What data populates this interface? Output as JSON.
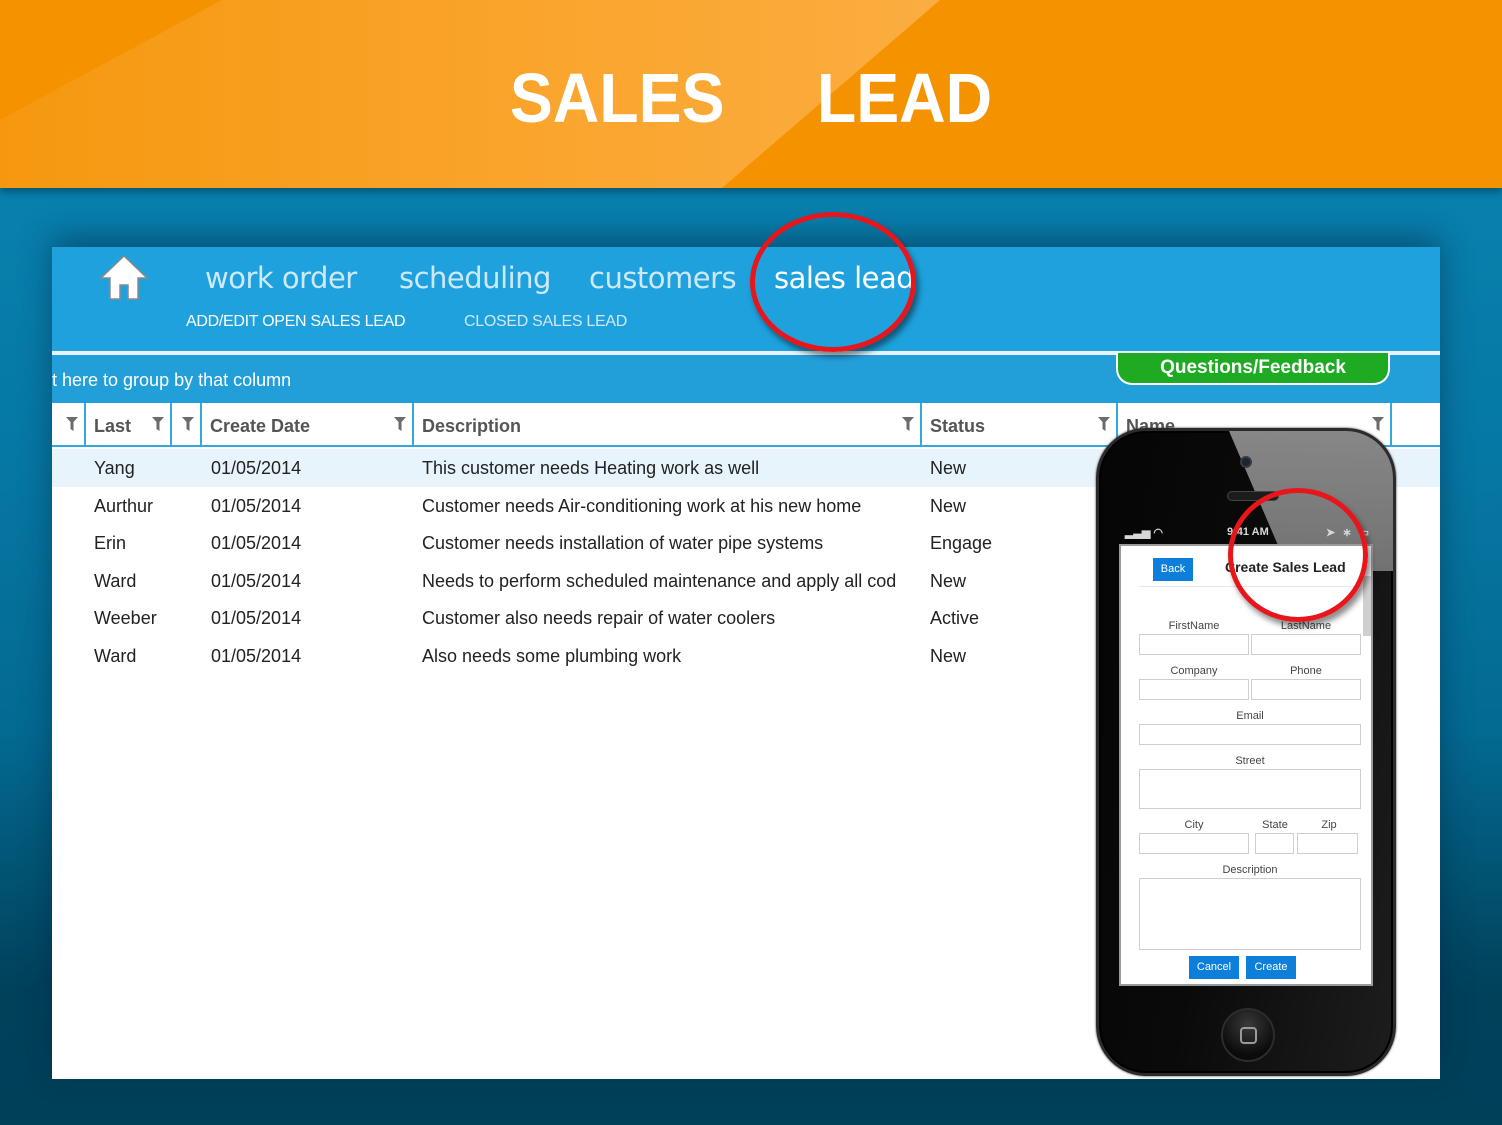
{
  "banner": {
    "title": "SALES   LEAD"
  },
  "nav": {
    "home_icon": "home-icon",
    "items": [
      {
        "label": "work order",
        "active": false
      },
      {
        "label": "scheduling",
        "active": false
      },
      {
        "label": "customers",
        "active": false
      },
      {
        "label": "sales lead",
        "active": true
      }
    ],
    "sub_items": [
      {
        "label": "ADD/EDIT OPEN SALES LEAD",
        "active": true
      },
      {
        "label": "CLOSED SALES LEAD",
        "active": false
      }
    ]
  },
  "group_bar": {
    "hint": "t here to group by that column",
    "feedback_label": "Questions/Feedback"
  },
  "grid": {
    "columns": [
      {
        "label": ""
      },
      {
        "label": "Last"
      },
      {
        "label": ""
      },
      {
        "label": "Create Date"
      },
      {
        "label": "Description"
      },
      {
        "label": "Status"
      },
      {
        "label": "Name"
      }
    ],
    "rows": [
      {
        "last": "Yang",
        "date": "01/05/2014",
        "description": "This customer needs Heating work as well",
        "status": "New",
        "selected": true
      },
      {
        "last": "Aurthur",
        "date": "01/05/2014",
        "description": "Customer needs Air-conditioning work at his new home",
        "status": "New",
        "selected": false
      },
      {
        "last": "Erin",
        "date": "01/05/2014",
        "description": "Customer needs installation of water pipe systems",
        "status": "Engage",
        "selected": false
      },
      {
        "last": "Ward",
        "date": "01/05/2014",
        "description": "Needs to perform scheduled maintenance and apply all cod",
        "status": "New",
        "selected": false
      },
      {
        "last": "Weeber",
        "date": "01/05/2014",
        "description": "Customer also needs repair of water coolers",
        "status": "Active",
        "selected": false
      },
      {
        "last": "Ward",
        "date": "01/05/2014",
        "description": "Also needs some plumbing work",
        "status": "New",
        "selected": false
      }
    ]
  },
  "phone": {
    "status_time": "9:41 AM",
    "form": {
      "back_label": "Back",
      "title": "Create Sales Lead",
      "fields": {
        "first_name": {
          "label": "FirstName",
          "value": ""
        },
        "last_name": {
          "label": "LastName",
          "value": ""
        },
        "company": {
          "label": "Company",
          "value": ""
        },
        "phone": {
          "label": "Phone",
          "value": ""
        },
        "email": {
          "label": "Email",
          "value": ""
        },
        "street": {
          "label": "Street",
          "value": ""
        },
        "city": {
          "label": "City",
          "value": ""
        },
        "state": {
          "label": "State",
          "value": ""
        },
        "zip": {
          "label": "Zip",
          "value": ""
        },
        "description": {
          "label": "Description",
          "value": ""
        }
      },
      "cancel_label": "Cancel",
      "create_label": "Create"
    }
  },
  "colors": {
    "banner_orange": "#f59200",
    "nav_blue": "#1ea1dc",
    "feedback_green": "#1faa23",
    "highlight_red": "#e8151b",
    "mobile_button_blue": "#0d7fdb"
  }
}
